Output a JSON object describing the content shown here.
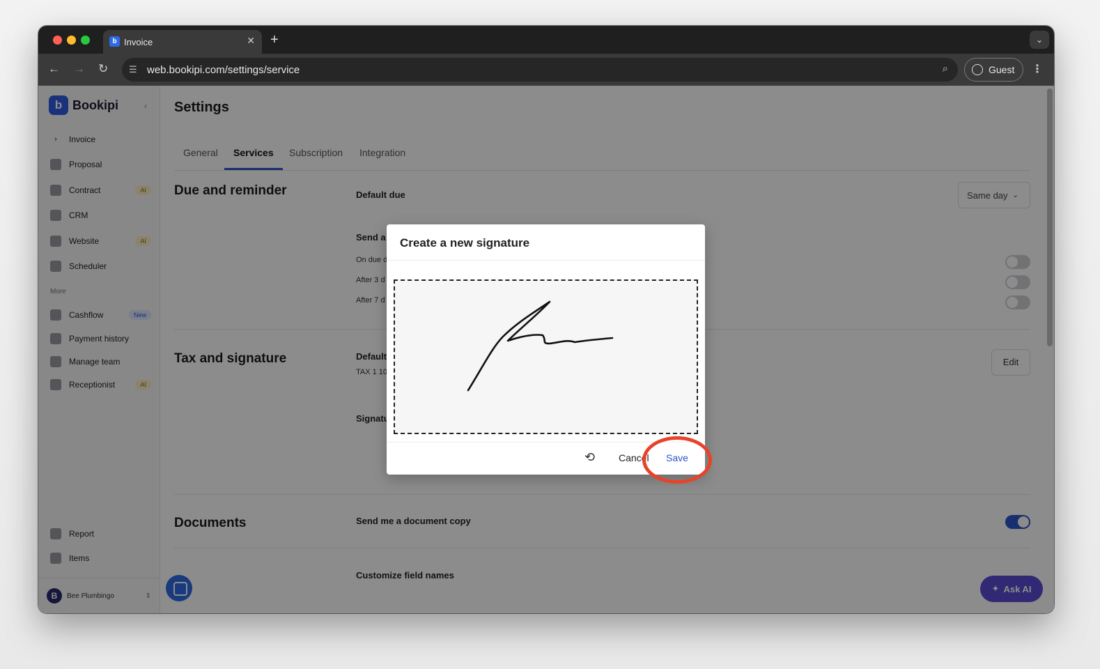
{
  "browser": {
    "tab_title": "Invoice",
    "tab_favicon_letter": "b",
    "address": "web.bookipi.com/settings/service",
    "profile_label": "Guest"
  },
  "sidebar": {
    "brand": "Bookipi",
    "items": [
      {
        "label": "Invoice",
        "badge": ""
      },
      {
        "label": "Proposal",
        "badge": ""
      },
      {
        "label": "Contract",
        "badge": "AI"
      },
      {
        "label": "CRM",
        "badge": ""
      },
      {
        "label": "Website",
        "badge": "AI"
      },
      {
        "label": "Scheduler",
        "badge": ""
      }
    ],
    "more_label": "More",
    "more_items": [
      {
        "label": "Cashflow",
        "badge": "New"
      },
      {
        "label": "Payment history",
        "badge": ""
      },
      {
        "label": "Manage team",
        "badge": ""
      },
      {
        "label": "Receptionist",
        "badge": "AI"
      }
    ],
    "bottom_items": [
      {
        "label": "Report"
      },
      {
        "label": "Items"
      }
    ],
    "user": {
      "initial": "B",
      "name": "Bee Plumbingo"
    }
  },
  "settings": {
    "title": "Settings",
    "tabs": [
      "General",
      "Services",
      "Subscription",
      "Integration"
    ],
    "active_tab": "Services",
    "due": {
      "section_title": "Due and reminder",
      "default_due_label": "Default due",
      "default_due_value": "Same day",
      "send_label": "Send a",
      "reminders": [
        "On due d",
        "After 3 d",
        "After 7 d"
      ]
    },
    "tax": {
      "section_title": "Tax and signature",
      "default_label": "Default",
      "tax_value": "TAX 1 10",
      "edit_label": "Edit",
      "signature_label": "Signatu"
    },
    "documents": {
      "section_title": "Documents",
      "send_copy_label": "Send me a document copy",
      "send_copy_enabled": true,
      "customize_label": "Customize field names"
    }
  },
  "modal": {
    "title": "Create a new signature",
    "cancel_label": "Cancel",
    "save_label": "Save"
  },
  "ask_ai_label": "Ask AI",
  "colors": {
    "accent": "#2f55c8",
    "highlight": "#e8432a",
    "ask_ai": "#5b4bd4"
  }
}
